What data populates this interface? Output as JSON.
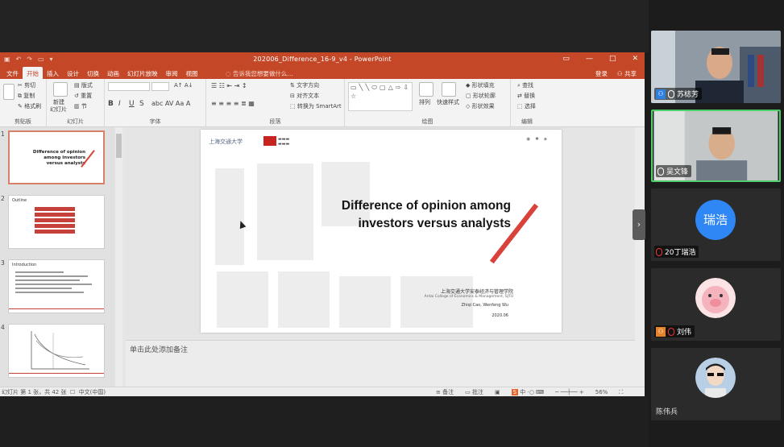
{
  "window": {
    "title": "202006_Difference_16-9_v4 - PowerPoint",
    "controls": [
      "—",
      "□",
      "✕"
    ]
  },
  "quick_access": [
    "save-icon",
    "undo-icon",
    "redo-icon",
    "present-icon"
  ],
  "ribbon_tabs": [
    "文件",
    "开始",
    "插入",
    "设计",
    "切换",
    "动画",
    "幻灯片放映",
    "审阅",
    "视图"
  ],
  "tell_me": "告诉我您想要做什么...",
  "account": {
    "login": "登录",
    "share": "共享"
  },
  "ribbon": {
    "clipboard": {
      "cut": "剪切",
      "copy": "复制",
      "format_painter": "格式刷",
      "label": "剪贴板"
    },
    "slides": {
      "new_slide": "新建",
      "new_slide2": "幻灯片",
      "layout": "版式",
      "reset": "重置",
      "section": "节",
      "label": "幻灯片"
    },
    "font": {
      "bold": "B",
      "italic": "I",
      "underline": "U",
      "shadow": "S",
      "label": "字体"
    },
    "paragraph": {
      "text_direction": "文字方向",
      "align_text": "对齐文本",
      "smartart": "转换为 SmartArt",
      "label": "段落"
    },
    "drawing": {
      "arrange": "排列",
      "quick_styles": "快速样式",
      "fill": "形状填充",
      "outline": "形状轮廓",
      "effect": "形状效果",
      "label": "绘图"
    },
    "editing": {
      "find": "查找",
      "replace": "替换",
      "select": "选择",
      "label": "编辑"
    }
  },
  "thumbnails": [
    {
      "num": "1",
      "title": "Difference of opinion among investors versus analysts"
    },
    {
      "num": "2",
      "title": "Outline"
    },
    {
      "num": "3",
      "title": "Introduction"
    },
    {
      "num": "4",
      "title": ""
    }
  ],
  "slide": {
    "title_line1": "Difference of opinion among",
    "title_line2": "investors versus analysts",
    "logo_left": "上海交通大学",
    "subtitle_cn": "上海交通大学安泰经济与管理学院",
    "subtitle_en": "Antai College of Economics & Management, SJTU",
    "authors": "Zhiqi Cao, Wenfeng Wu",
    "date": "2020.06"
  },
  "notes_placeholder": "单击此处添加备注",
  "status": {
    "slide_info": "幻灯片 第 1 张，共 42 张",
    "language": "中文(中国)",
    "notes": "备注",
    "comments": "批注",
    "zoom": "56%",
    "ime": "中"
  },
  "participants": [
    {
      "name": "苏梽芳",
      "type": "video",
      "muted": false,
      "badge": "host"
    },
    {
      "name": "吴文锋",
      "type": "video",
      "muted": false,
      "active": true
    },
    {
      "name": "20丁瑞浩",
      "type": "avatar-text",
      "avatar_text": "瑞浩",
      "avatar_color": "#2f86f5",
      "muted": true
    },
    {
      "name": "刘伟",
      "type": "avatar-pig",
      "muted": true,
      "badge": "cohost"
    },
    {
      "name": "陈伟兵",
      "type": "avatar-person",
      "muted": false
    }
  ]
}
